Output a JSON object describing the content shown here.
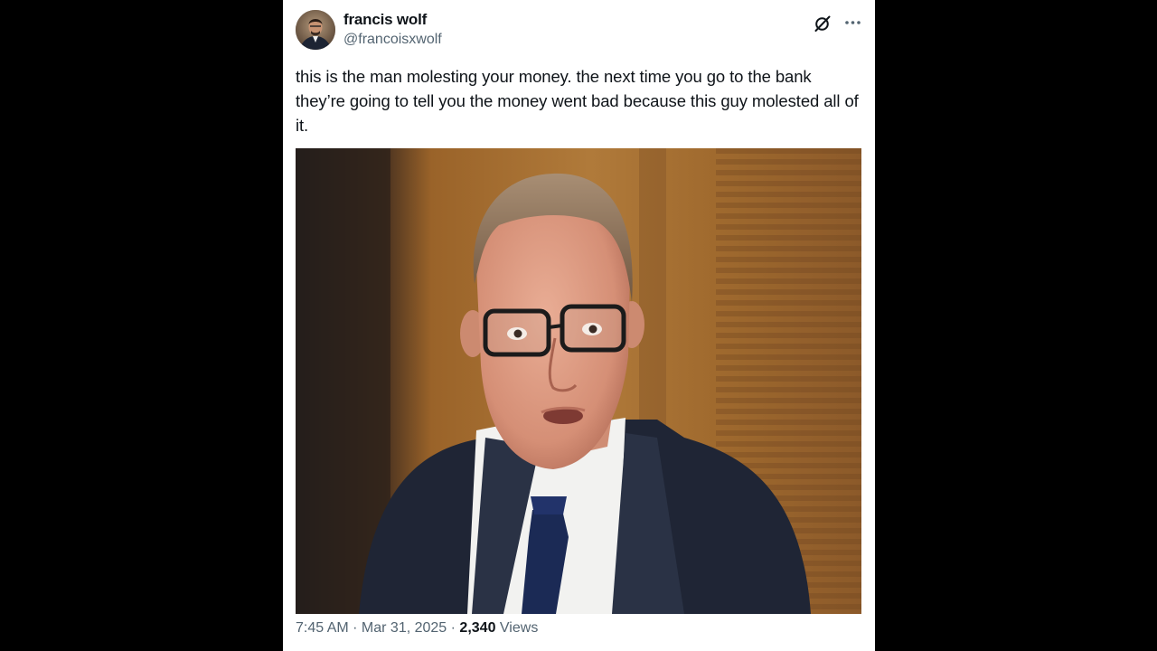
{
  "author": {
    "display_name": "francis wolf",
    "handle": "@francoisxwolf"
  },
  "icons": {
    "avatar": "avatar-portrait",
    "grok": "grok-slash-circle-icon",
    "more": "more-dots-icon"
  },
  "tweet": {
    "text": "this is the man molesting your money. the next time you go to the bank they’re going to tell you the money went bad because this guy molested all of it."
  },
  "meta": {
    "time": "7:45 AM",
    "separator": " · ",
    "date": "Mar 31, 2025",
    "views_count": "2,340",
    "views_label": "Views"
  },
  "colors": {
    "text_primary": "#0f1419",
    "text_secondary": "#536471",
    "background": "#000000",
    "card": "#ffffff"
  }
}
